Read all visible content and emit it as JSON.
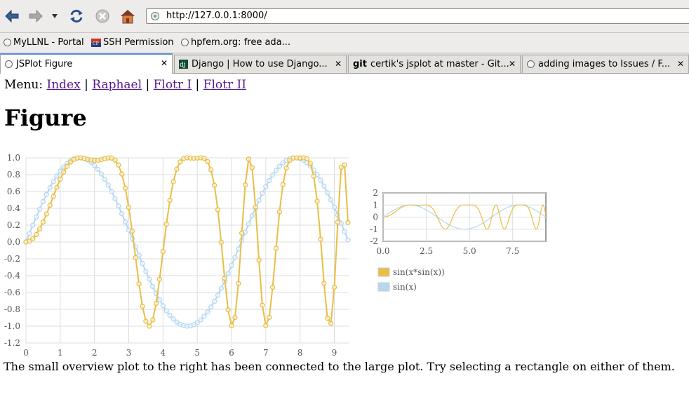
{
  "browser": {
    "url": "http://127.0.0.1:8000/",
    "bookmarks": [
      "MyLLNL - Portal",
      "SSH Permission",
      "hpfem.org: free ada..."
    ],
    "tabs": [
      {
        "title": "JSPlot Figure",
        "active": true
      },
      {
        "title": "Django | How to use Django...",
        "active": false
      },
      {
        "title": "certik's jsplot at master - Git...",
        "active": false
      },
      {
        "title": "adding images to Issues / F...",
        "active": false
      }
    ],
    "close_glyph": "✕"
  },
  "page": {
    "menu_label": "Menu:",
    "separator": "|",
    "menu_links": [
      "Index",
      "Raphael",
      "Flotr I",
      "Flotr II"
    ],
    "heading": "Figure",
    "note": "The small overview plot to the right has been connected to the large plot. Try selecting a rectangle on either of them."
  },
  "colors": {
    "series1": "#e8be45",
    "series2": "#b5d7f2",
    "grid": "#dddddd",
    "tick_text": "#555555",
    "link": "#551a8b"
  },
  "chart_data": [
    {
      "type": "line",
      "name": "main-plot",
      "x_range": [
        0,
        9.42
      ],
      "ylim": [
        -1.2,
        1.0
      ],
      "x_ticks": [
        0,
        1,
        2,
        3,
        4,
        5,
        6,
        7,
        8,
        9
      ],
      "y_ticks": [
        "1.0",
        "0.8",
        "0.6",
        "0.4",
        "0.2",
        "0.0",
        "-0.2",
        "-0.4",
        "-0.6",
        "-0.8",
        "-1.0",
        "-1.2"
      ],
      "sample_step": 0.1,
      "series": [
        {
          "name": "sin(x*sin(x))",
          "function": "sin(x*sin(x))",
          "color": "#e8be45",
          "markers": true
        },
        {
          "name": "sin(x)",
          "function": "sin(x)",
          "color": "#b5d7f2",
          "markers": true
        }
      ],
      "grid": true
    },
    {
      "type": "line",
      "name": "overview-plot",
      "x_range": [
        0,
        9.42
      ],
      "ylim": [
        -2,
        2
      ],
      "x_ticks": [
        "0.0",
        "2.5",
        "5.0",
        "7.5"
      ],
      "y_ticks": [
        "2",
        "1",
        "0",
        "-1",
        "-2"
      ],
      "legend": {
        "position": "below",
        "entries": [
          {
            "label": "sin(x*sin(x))",
            "color": "#e8be45"
          },
          {
            "label": "sin(x)",
            "color": "#b5d7f2"
          }
        ]
      },
      "grid": true
    }
  ]
}
